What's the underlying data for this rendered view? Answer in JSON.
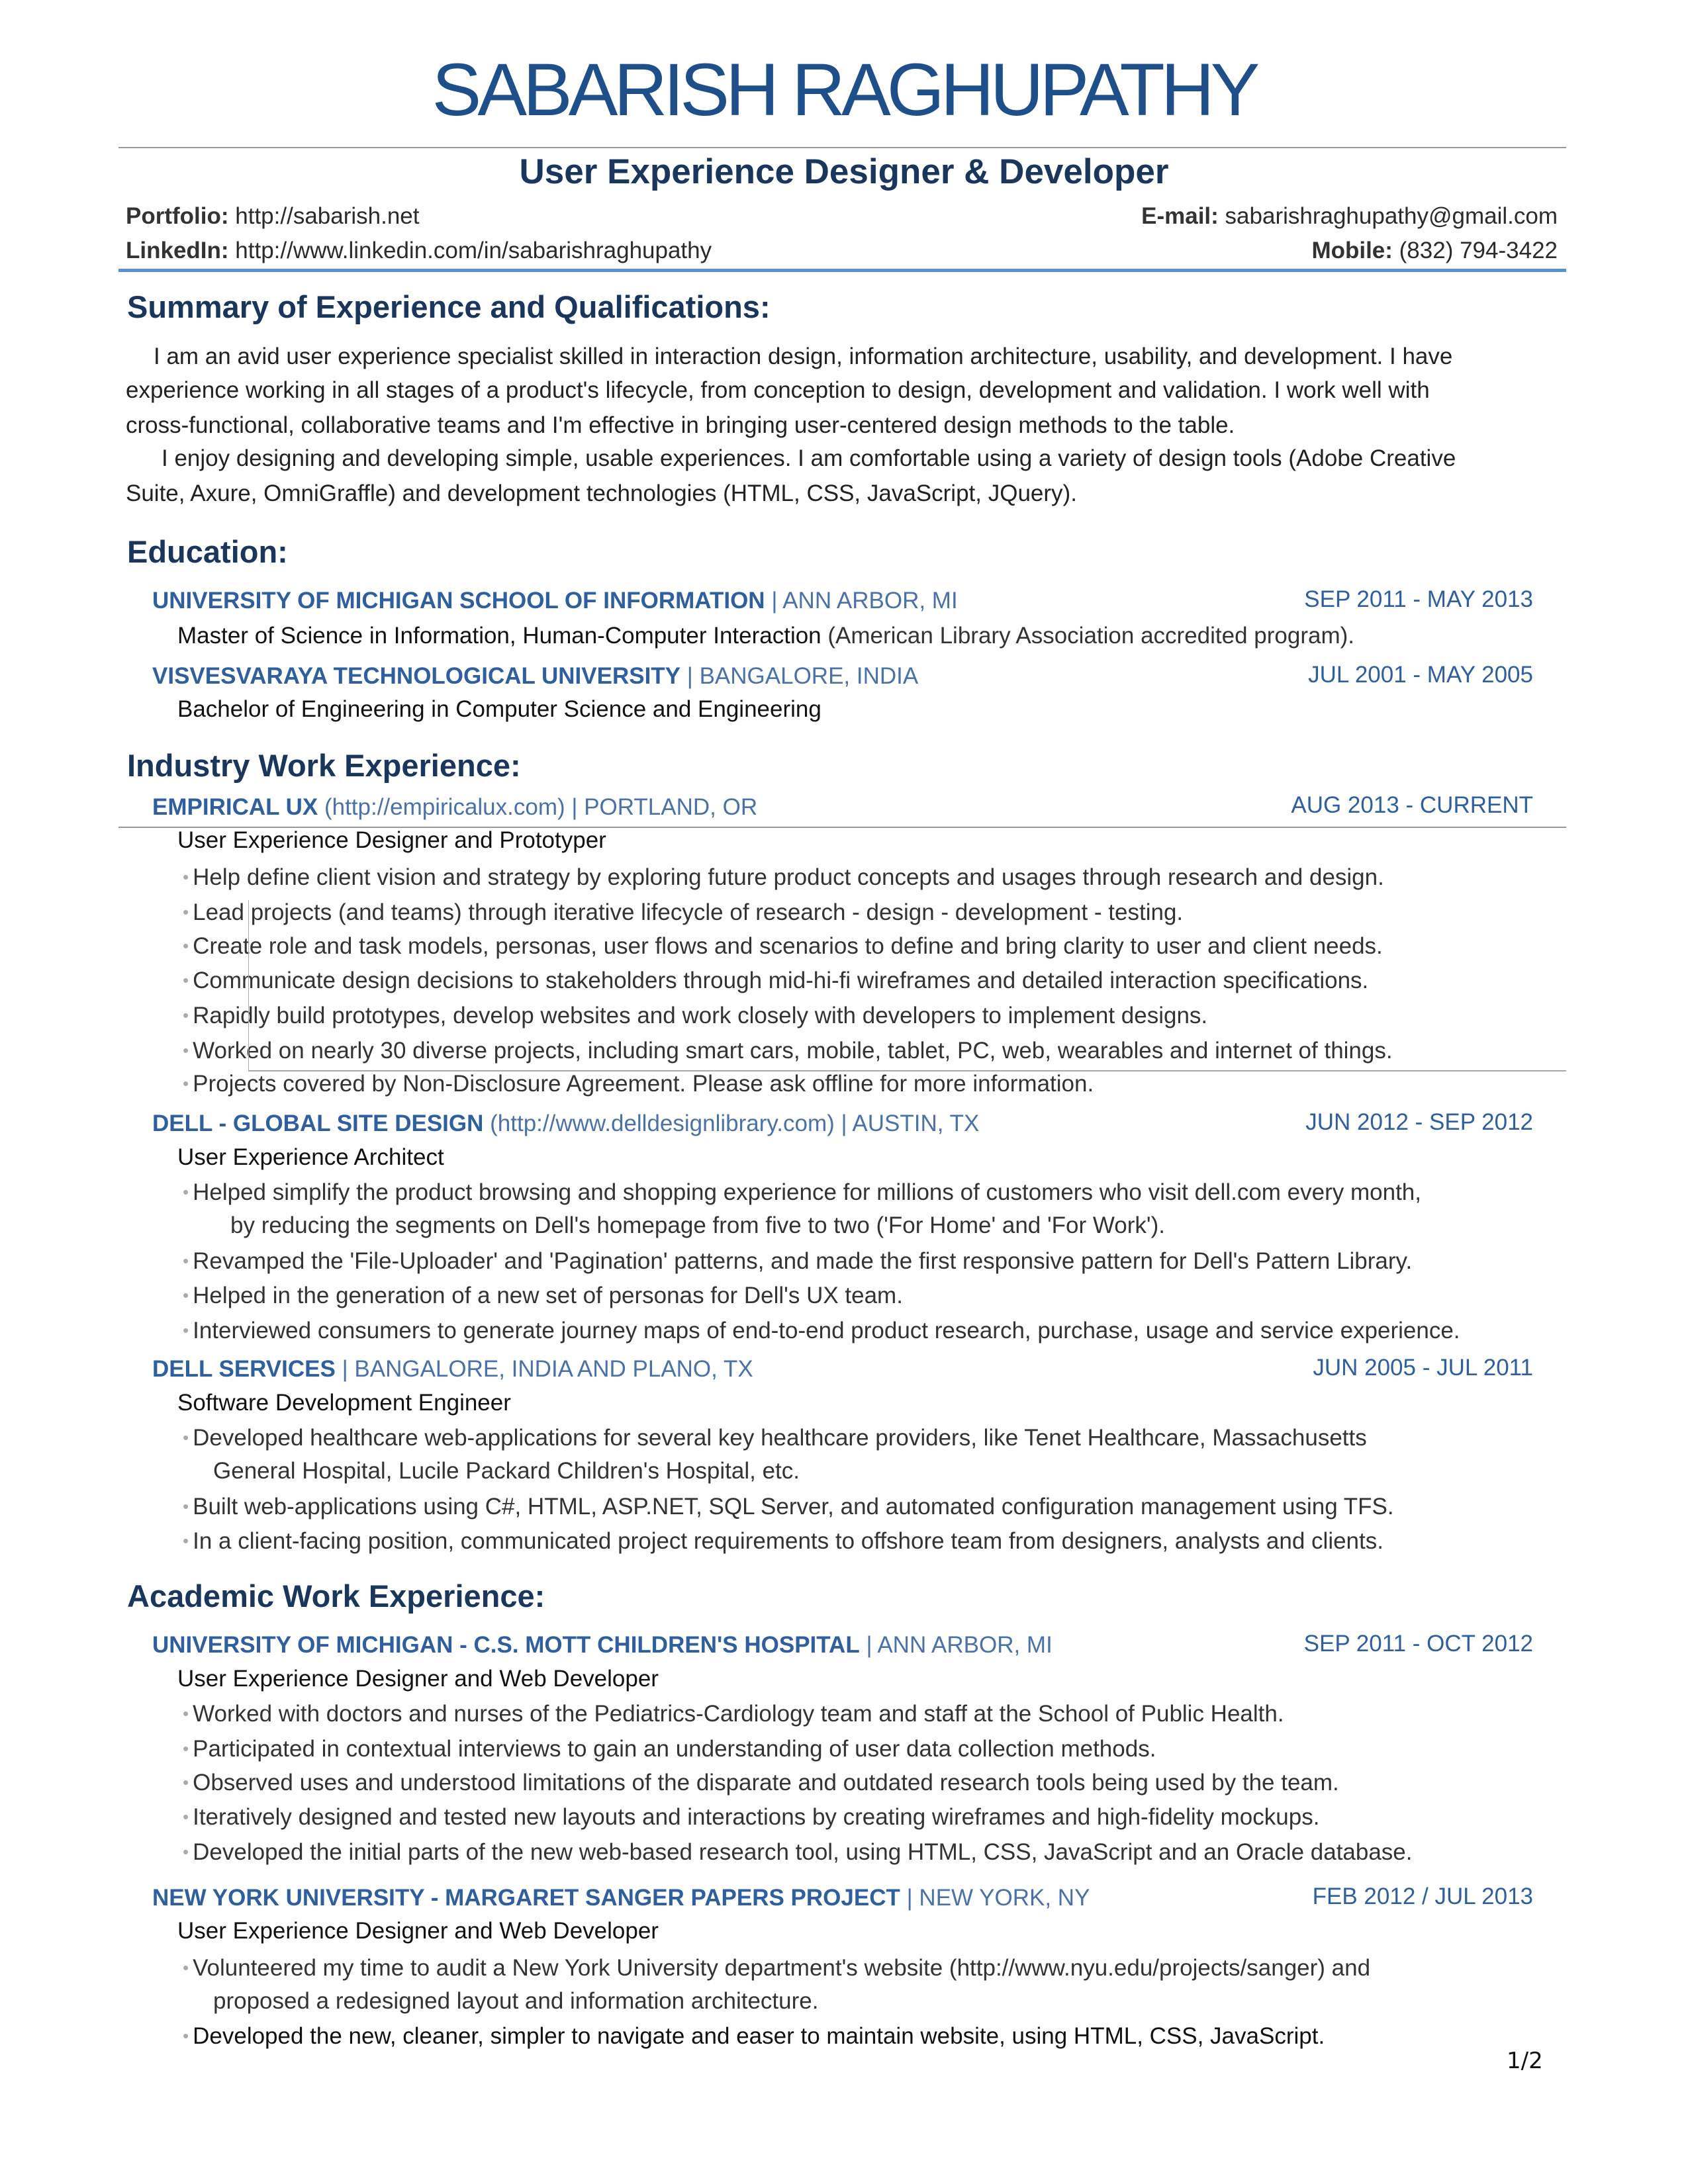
{
  "header": {
    "name": "SABARISH RAGHUPATHY",
    "title": "User Experience Designer & Developer",
    "contact": {
      "portfolio_label": "Portfolio:",
      "portfolio": "http://sabarish.net",
      "linkedin_label": "LinkedIn:",
      "linkedin": "http://www.linkedin.com/in/sabarishraghupathy",
      "email_label": "E-mail:",
      "email": "sabarishraghupathy@gmail.com",
      "mobile_label": "Mobile:",
      "mobile": "(832) 794-3422"
    }
  },
  "summary": {
    "heading": "Summary of Experience and Qualifications:",
    "lines": [
      "I am an avid user experience specialist skilled in interaction design, information architecture, usability, and development. I have",
      "experience working in all stages of a product's lifecycle, from conception to design, development and validation. I work well with",
      "cross-functional, collaborative teams and I'm effective in bringing user-centered design methods to the table.",
      "I enjoy designing and developing simple, usable experiences. I am comfortable using a variety of design tools (Adobe Creative",
      "Suite, Axure, OmniGraffle) and development technologies (HTML, CSS, JavaScript, JQuery)."
    ]
  },
  "education": {
    "heading": "Education:",
    "schools": [
      {
        "name": "UNIVERSITY OF MICHIGAN SCHOOL OF INFORMATION",
        "location": "| ANN ARBOR, MI",
        "dates": "SEP 2011 - MAY 2013",
        "degree": "Master of Science in Information, Human-Computer Interaction",
        "note": " (American Library Association accredited program)."
      },
      {
        "name": "VISVESVARAYA TECHNOLOGICAL UNIVERSITY",
        "location": "| BANGALORE, INDIA",
        "dates": "JUL 2001 - MAY 2005",
        "degree": "Bachelor of Engineering in Computer Science and Engineering"
      }
    ]
  },
  "industry": {
    "heading": "Industry Work Experience:",
    "jobs": [
      {
        "company": "EMPIRICAL UX",
        "url": " (http://empiricalux.com)",
        "location": " | PORTLAND, OR",
        "dates": "AUG 2013 - CURRENT",
        "role": "User Experience Designer and Prototyper",
        "bullets": [
          "Help define client vision and strategy by exploring future product concepts and usages through research and design.",
          "Lead projects (and teams) through iterative lifecycle of research - design - development - testing.",
          "Create role and task models, personas, user flows and scenarios to define and bring clarity to user and client needs.",
          "Communicate design decisions to stakeholders through mid-hi-fi wireframes and detailed interaction specifications.",
          "Rapidly build prototypes, develop websites and work closely with developers to implement designs.",
          "Worked on nearly 30 diverse projects, including smart cars, mobile, tablet, PC, web, wearables and internet of things.",
          "Projects covered by Non-Disclosure Agreement. Please ask offline for more information."
        ]
      },
      {
        "company": "DELL - GLOBAL SITE DESIGN",
        "url": " (http://www.delldesignlibrary.com)",
        "location": " |  AUSTIN, TX",
        "dates": "JUN 2012 - SEP 2012",
        "role": "User Experience Architect",
        "bullets": [
          "Helped simplify the product browsing and shopping experience for millions of customers who visit dell.com every month,",
          "by reducing the segments on Dell's homepage from five to two ('For Home' and 'For Work').",
          "Revamped the 'File-Uploader' and 'Pagination' patterns, and made the first responsive pattern for Dell's Pattern Library.",
          "Helped in the generation of a new set of personas for Dell's UX team.",
          "Interviewed consumers to generate journey maps of end-to-end product research, purchase, usage and service experience."
        ]
      },
      {
        "company": "DELL SERVICES",
        "location": " | BANGALORE, INDIA AND PLANO, TX",
        "dates": "JUN 2005 - JUL 2011",
        "role": "Software Development Engineer",
        "bullets": [
          "Developed healthcare web-applications for several key healthcare providers, like Tenet Healthcare, Massachusetts",
          "General Hospital, Lucile Packard Children's Hospital, etc.",
          "Built web-applications using C#, HTML, ASP.NET, SQL Server, and automated configuration management using TFS.",
          "In a client-facing position, communicated project requirements to offshore team from designers, analysts and clients."
        ]
      }
    ]
  },
  "academic": {
    "heading": "Academic Work Experience:",
    "jobs": [
      {
        "company": "UNIVERSITY OF MICHIGAN - C.S. MOTT CHILDREN'S HOSPITAL",
        "location": " | ANN ARBOR, MI",
        "dates": "SEP 2011 - OCT 2012",
        "role": "User Experience Designer and Web Developer",
        "bullets": [
          "Worked with doctors and nurses of the Pediatrics-Cardiology team and staff at the School of Public Health.",
          "Participated in contextual interviews to gain an understanding of user data collection methods.",
          "Observed uses and understood limitations of the disparate and outdated research tools being used by the team.",
          "Iteratively designed and tested new layouts and interactions by creating wireframes and high-fidelity mockups.",
          "Developed the initial parts of the new web-based research tool, using HTML, CSS, JavaScript and an Oracle database."
        ]
      },
      {
        "company": "NEW YORK UNIVERSITY - MARGARET SANGER PAPERS PROJECT",
        "location": " | NEW YORK, NY",
        "dates": "FEB 2012 / JUL 2013",
        "role": "User Experience Designer and Web Developer",
        "bullets": [
          "Volunteered my time to audit a New York University department's website (http://www.nyu.edu/projects/sanger) and",
          "proposed a redesigned layout and information architecture.",
          "Developed the new, cleaner, simpler to navigate and easer to maintain website, using HTML, CSS, JavaScript."
        ]
      }
    ]
  },
  "footer": {
    "page": "1/2"
  }
}
